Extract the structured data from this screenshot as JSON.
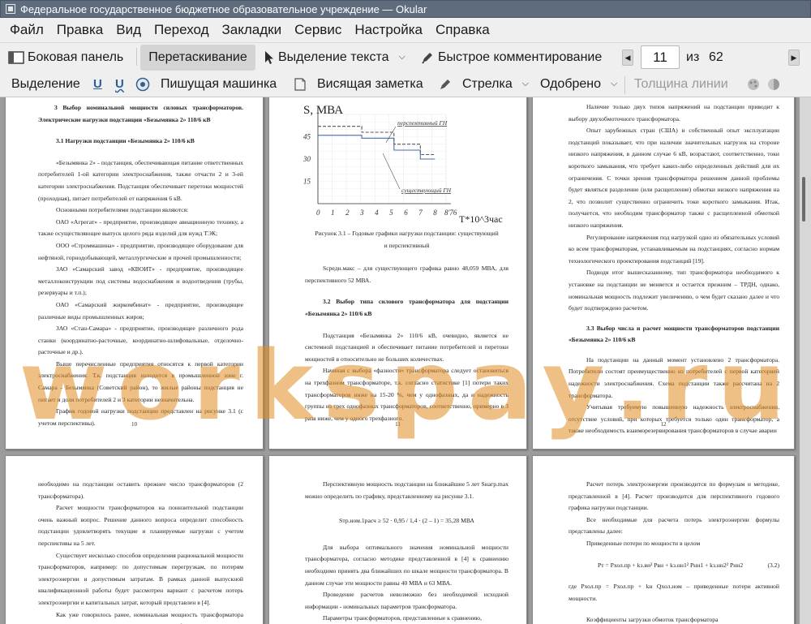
{
  "window": {
    "title": "Федеральное государственное бюджетное образовательное учреждение — Okular"
  },
  "menu": [
    "Файл",
    "Правка",
    "Вид",
    "Переход",
    "Закладки",
    "Сервис",
    "Настройка",
    "Справка"
  ],
  "toolbar1": {
    "sidebar": "Боковая панель",
    "drag": "Перетаскивание",
    "text_select": "Выделение текста",
    "quick_comment": "Быстрое комментирование",
    "page_current": "11",
    "page_of": "из",
    "page_total": "62"
  },
  "toolbar2": {
    "select": "Выделение",
    "typewriter": "Пишущая машинка",
    "pinned_note": "Висящая заметка",
    "arrow": "Стрелка",
    "approved": "Одобрено",
    "line_width": "Толщина линии"
  },
  "watermark": "worksрау.ru",
  "pages": {
    "p10": {
      "heading": "3 Выбор номинальной мощности силовых трансформаторов. Электрические нагрузки подстанции «Безымянка 2» 110/6 кВ",
      "subheading": "3.1 Нагрузки подстанции «Безымянка 2» 110/6 кВ",
      "paras": [
        "«Безымянка 2» - подстанция, обеспечивающая питание ответственных потребителей 1-ой категории электроснабжения, также отчасти 2 и 3-ей категории электроснабжения. Подстанция обеспечивает перетоки мощностей (проходная), питает потребителей от напряжения 6 кВ.",
        "Основными потребителями подстанции являются:",
        "ОАО «Агрегат» - предприятие, производящее авиационную технику, а также осуществляющее выпуск целого ряда изделий для нужд ТЭК;",
        "ООО «Строммашина» - предприятие, производящее оборудование для нефтяной, горнодобывающей, металлургические и прочей промышленности;",
        "ЗАО «Самарский завод «КВОИТ» - предприятие, производящее металлоконструкции под системы водоснабжения и водоотведения (трубы, резервуары и т.п.);",
        "ОАО «Самарский жиркомбинат» - предприятие, производящее различные виды промышленных жиров;",
        "ЗАО «Стан-Самара» - предприятие, производящее различного рода станки (координатно-расточные, координатно-шлифовальные, отделочно-расточные и др.).",
        "Выше перечисленные предприятия относятся к первой категории электроснабжения. Т.к. подстанция находится в промышленной зоне г. Самара - Безымянка (Советский район), то жилые районы подстанция не питает и доля потребителей 2 и 3 категории незначительна.",
        "График годовой нагрузки подстанции представлен на рисунке 3.1 (с учетом перспективы)."
      ],
      "number": "10"
    },
    "p11": {
      "chart_ylabel": "S, МВА",
      "chart_xlabel": "T*10^3час",
      "caption": "Рисунок 3.1 – Годовые графики нагрузки подстанции: существующий и перспективный",
      "para1": "Sсредн.макс – для существующего графика равно 48,059 МВА, для перспективного 52 МВА.",
      "heading": "3.2 Выбор типа силового трансформатора для подстанции «Безымянка 2» 110/6 кВ",
      "para2": "Подстанция «Безымянка 2» 110/6 кВ, очевидно, является не системной подстанцией и обеспечивает питание потребителей и перетоки мощностей в относительно не больших количествах.",
      "para3": "Начиная с выбора «фазности» трансформатора следует остановиться на трехфазном трансформаторе, т.к. согласно статистике [1] потери таких трансформаторов ниже на 15-20 %, чем у однофазных, да и надежность группы из трех однофазных трансформаторов, соответственно, примерно в 3 раза ниже, чем у одного трехфазного.",
      "number": "11"
    },
    "p12": {
      "paras": [
        "Наличие только двух типов напряжений на подстанции приводит к выбору двухобмоточного трансформатора.",
        "Опыт зарубежных стран (США) и собственный опыт эксплуатации подстанций показывает, что при наличии значительных нагрузок на стороне низкого напряжения, в данном случае 6 кВ, возрастают, соответственно, токи короткого замыкания, что требует каких-либо определенных действий для их ограничения. С точки зрения трансформатора решением данной проблемы будет являться разделение (или расщепление) обмотки низкого напряжения на 2, что позволит существенно ограничить токи короткого замыкания. Итак, получается, что необходим трансформатор также с расщепленной обмоткой низкого напряжения.",
        "Регулирование напряжения под нагрузкой одно из обязательных условий ко всем трансформаторам, устанавливаемым на подстанциях, согласно нормам технологического проектирования подстанций [19].",
        "Подводя итог вышесказанному, тип трансформатора необходимого к установке на подстанции не меняется и остается прежним – ТРДН, однако, номинальная мощность подлежит увеличению, о чем будет сказано далее и что будет подтверждено расчетом."
      ],
      "heading": "3.3 Выбор числа и расчет мощности трансформаторов подстанции «Безымянка 2» 110/6 кВ",
      "paras2": [
        "На подстанции на данный момент установлено 2 трансформатора. Потребители состоят преимущественно из потребителей с первой категорией надежности электроснабжения. Схема подстанции также рассчитана на 2 трансформатора.",
        "Учитывая требуемую повышенную надежность электроснабжения, отсутствие условий, при которых требуется только один трансформатор, а также необходимость взаиморезервирования трансформаторов в случае аварии"
      ],
      "number": "12"
    },
    "p13": {
      "paras": [
        "необходимо на подстанции оставить прежнее число трансформаторов (2 трансформатора).",
        "Расчет мощности трансформаторов на понизительной подстанции очень важный вопрос. Решение данного вопроса определит способность подстанции удовлетворять текущие и планируемые нагрузки с учетом перспективы на 5 лет.",
        "Существует несколько способов определения рациональной мощности трансформаторов, например: по допустимым перегрузкам, по потерям электроэнергии и допустимым затратам. В рамках данной выпускной квалификационной работы будет рассмотрен вариант с расчетом потерь электроэнергии и капитальных затрат, который представлен в [4].",
        "Как уже говорилось ранее, номинальная мощность трансформатора рассчитывается с учетом аварийного режима работы подстанции, при котором"
      ]
    },
    "p14": {
      "para1": "Перспективную мощность подстанции на ближайшие 5 лет Sнагр.max можно определить по графику, представленному на рисунке 3.1.",
      "formula": "Sтр.ном.1расч ≥ 52 · 0,95 / 1,4 · (2 – 1) = 35,28 МВА",
      "para2": "Для выбора оптимального значения номинальной мощности трансформатора, согласно методике представленной в [4] к сравнению необходимо принять два ближайших по шкале мощности трансформатора. В данном случае эти мощности равны 40 МВА и 63 МВА.",
      "para3": "Проведение расчетов невозможно без необходимой исходной информации - номинальных параметров трансформатора.",
      "para4": "Параметры трансформаторов, представленные к сравнению,"
    },
    "p15": {
      "para1": "Расчет потерь электроэнергии производится по формулам и методике, представленной в [4]. Расчет производится для перспективного годового графика нагрузки подстанции.",
      "para2": "Все необходимые для расчета потерь электроэнергии формулы представлены далее:",
      "para3": "Приведенные потери по мощности в целом",
      "formula": "Pт = Pхол.пр + kз.вн² Pвн + kз.нн1² Pнн1 + kз.нн2² Pнн2",
      "formula_num": "(3.2)",
      "para4": "где Pхол.пр = Pхол.пр + kн Qхол.ном – приведенные потери активной мощности.",
      "para5": "Коэффициенты загрузки обмоток трансформатора"
    }
  },
  "chart_data": {
    "type": "line",
    "ylabel": "S, МВА",
    "xlabel": "T*10^3час",
    "x_ticks": [
      "0",
      "1",
      "2",
      "3",
      "4",
      "5",
      "6",
      "7",
      "8",
      "8'76"
    ],
    "y_ticks": [
      "15",
      "30",
      "45"
    ],
    "ylim": [
      0,
      60
    ],
    "series": [
      {
        "name": "перспективный ГН",
        "style": "dashed",
        "color": "#555555",
        "points": [
          [
            0,
            52
          ],
          [
            3,
            52
          ],
          [
            3,
            48
          ],
          [
            5.2,
            48
          ],
          [
            5.2,
            40
          ],
          [
            7,
            40
          ],
          [
            7,
            33
          ],
          [
            8,
            33
          ]
        ]
      },
      {
        "name": "существующий ГН",
        "style": "solid",
        "color": "#4a6fa5",
        "points": [
          [
            0,
            46
          ],
          [
            3,
            46
          ],
          [
            3,
            44
          ],
          [
            5.2,
            44
          ],
          [
            5.2,
            36
          ],
          [
            7,
            36
          ],
          [
            7,
            30
          ],
          [
            8,
            30
          ]
        ]
      }
    ]
  }
}
